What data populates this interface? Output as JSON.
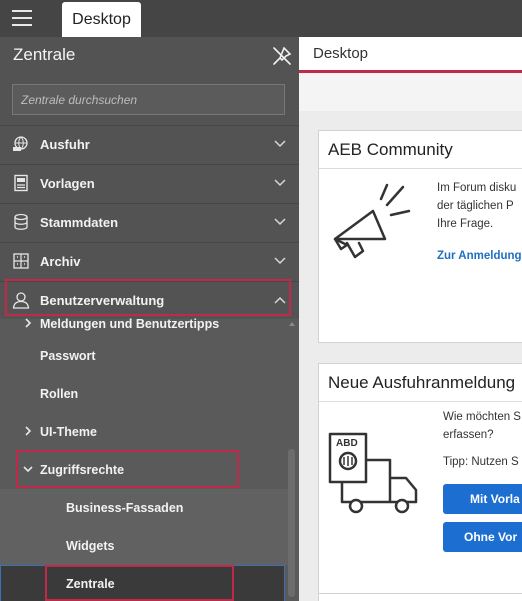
{
  "topbar": {
    "tab_label": "Desktop"
  },
  "sidebar": {
    "title": "Zentrale",
    "search_placeholder": "Zentrale durchsuchen",
    "items": [
      {
        "label": "Ausfuhr",
        "icon": "globe-truck-icon"
      },
      {
        "label": "Vorlagen",
        "icon": "template-icon"
      },
      {
        "label": "Stammdaten",
        "icon": "database-icon"
      },
      {
        "label": "Archiv",
        "icon": "archive-icon"
      },
      {
        "label": "Benutzerverwaltung",
        "icon": "user-icon"
      }
    ],
    "subitems": [
      {
        "label": "Meldungen und Benutzertipps"
      },
      {
        "label": "Passwort"
      },
      {
        "label": "Rollen"
      },
      {
        "label": "UI-Theme"
      },
      {
        "label": "Zugriffsrechte"
      },
      {
        "label": "Business-Fassaden"
      },
      {
        "label": "Widgets"
      },
      {
        "label": "Zentrale"
      }
    ]
  },
  "main": {
    "tab_label": "Desktop",
    "community": {
      "title": "AEB Community",
      "text_lines": [
        "Im Forum disku",
        "der täglichen P",
        "Ihre Frage."
      ],
      "link": "Zur Anmeldung"
    },
    "export": {
      "title": "Neue Ausfuhranmeldung",
      "icon_text": "ABD",
      "question_lines": [
        "Wie möchten S",
        "erfassen?"
      ],
      "tip": "Tipp: Nutzen S",
      "button1": "Mit Vorla",
      "button2": "Ohne Vor"
    }
  },
  "colors": {
    "highlight": "#c0294a",
    "accent_blue": "#1c6fd0",
    "sidebar_bg": "#535353",
    "topbar_bg": "#454545"
  }
}
